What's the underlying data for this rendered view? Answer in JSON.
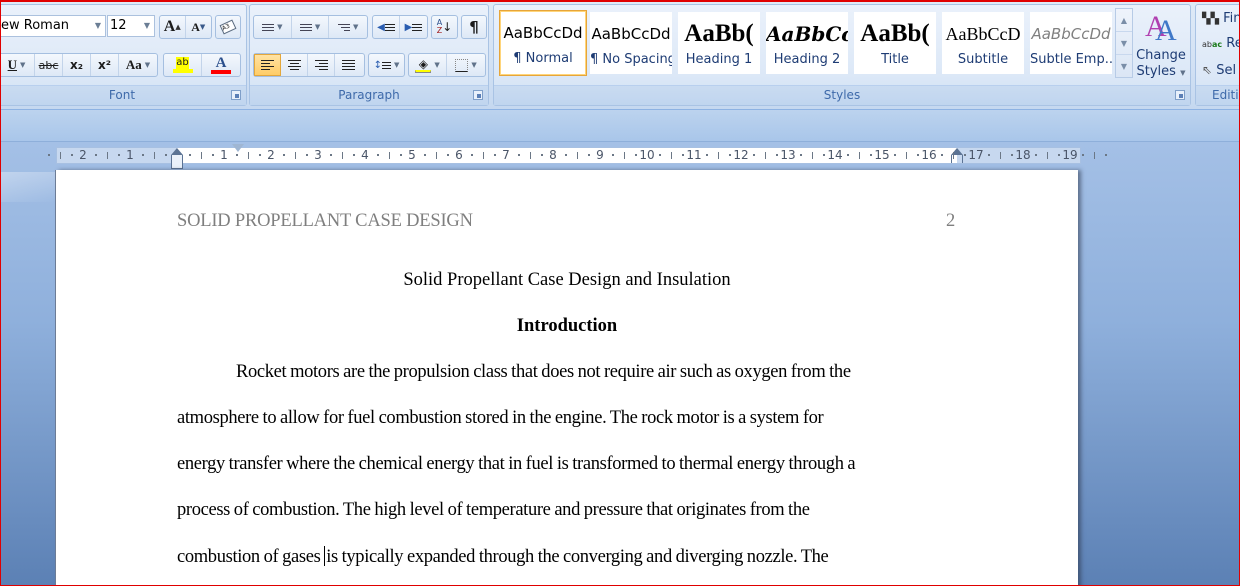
{
  "ribbon": {
    "font_group": {
      "label": "Font",
      "font_name": "ew Roman",
      "font_size": "12",
      "grow_font": "A",
      "shrink_font": "A",
      "underline": "U",
      "strikethrough": "abc",
      "subscript": "x₂",
      "superscript": "x²",
      "change_case": "Aa",
      "highlight": "ab",
      "font_color": "A",
      "highlight_color": "#ffff00",
      "font_color_value": "#ff0000"
    },
    "paragraph_group": {
      "label": "Paragraph",
      "sort": "A↓Z",
      "show_marks": "¶"
    },
    "styles_group": {
      "label": "Styles",
      "styles": [
        {
          "sample": "AaBbCcDd",
          "name": "¶ Normal",
          "selected": true
        },
        {
          "sample": "AaBbCcDd",
          "name": "¶ No Spacing",
          "selected": false
        },
        {
          "sample": "AaBb(",
          "name": "Heading 1",
          "selected": false
        },
        {
          "sample": "AaBbCc",
          "name": "Heading 2",
          "selected": false
        },
        {
          "sample": "AaBb(",
          "name": "Title",
          "selected": false
        },
        {
          "sample": "AaBbCcD",
          "name": "Subtitle",
          "selected": false
        },
        {
          "sample": "AaBbCcDd",
          "name": "Subtle Emp...",
          "selected": false
        }
      ],
      "change_styles_line1": "Change",
      "change_styles_line2": "Styles"
    },
    "editing_group": {
      "label": "Editi",
      "find": "Fin",
      "replace": "Rep",
      "select": "Sel"
    }
  },
  "ruler": {
    "left_labels": [
      "2",
      "1"
    ],
    "right_labels": [
      "1",
      "2",
      "3",
      "4",
      "5",
      "6",
      "7",
      "8",
      "9",
      "10",
      "11",
      "12",
      "13",
      "14",
      "15",
      "16",
      "17",
      "18",
      "19"
    ]
  },
  "document": {
    "header": "SOLID PROPELLANT CASE DESIGN",
    "page_number": "2",
    "title": "Solid Propellant Case Design and Insulation",
    "heading": "Introduction",
    "lines": [
      "Rocket motors are the propulsion class that does not require air such as oxygen from the",
      "atmosphere to allow for fuel combustion stored in the engine.  The rock motor is a system for",
      "energy transfer where the chemical energy that in fuel is transformed to thermal energy through a",
      "process of combustion.   The high level of temperature and pressure that originates from the"
    ],
    "last_line_before_caret": "combustion of gases ",
    "last_line_after_caret": "is typically expanded through the converging and diverging nozzle. The"
  }
}
